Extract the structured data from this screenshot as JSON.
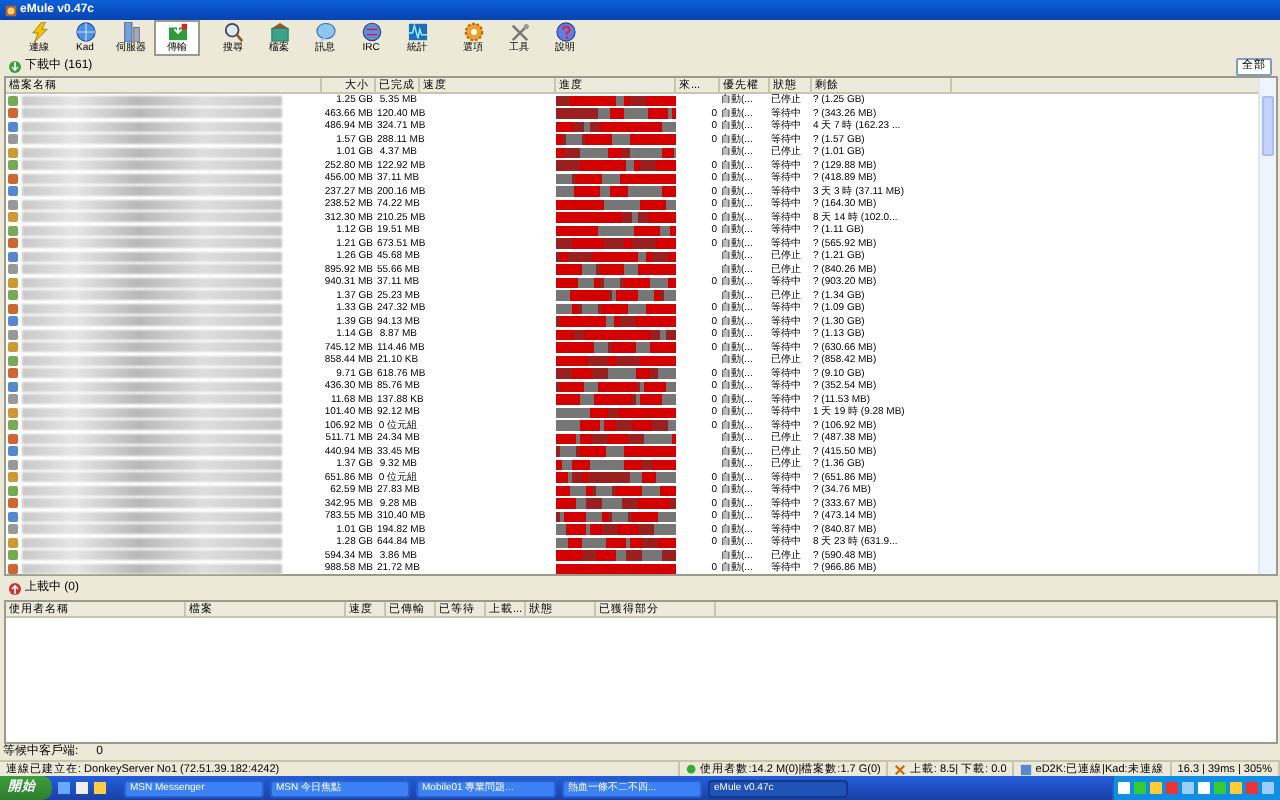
{
  "window": {
    "title": "eMule v0.47c"
  },
  "toolbar": [
    {
      "label": "連線",
      "selected": false
    },
    {
      "label": "Kad",
      "selected": false
    },
    {
      "label": "伺服器",
      "selected": false
    },
    {
      "label": "傳輸",
      "selected": true
    },
    {
      "label": "搜尋",
      "selected": false
    },
    {
      "label": "檔案",
      "selected": false
    },
    {
      "label": "訊息",
      "selected": false
    },
    {
      "label": "IRC",
      "selected": false
    },
    {
      "label": "統計",
      "selected": false
    },
    {
      "label": "選項",
      "selected": false
    },
    {
      "label": "工具",
      "selected": false
    },
    {
      "label": "說明",
      "selected": false
    }
  ],
  "downloads": {
    "tab": "下載中 (161)",
    "filter_button": "全部",
    "columns": [
      "檔案名稱",
      "大小",
      "已完成",
      "速度",
      "進度",
      "來...",
      "優先權",
      "狀態",
      "剩餘"
    ],
    "rows": [
      {
        "size": "1.25 GB",
        "completed": "5.35 MB",
        "sources": "",
        "priority": "自動(...",
        "status": "已停止",
        "remaining": "? (1.25 GB)"
      },
      {
        "size": "463.66 MB",
        "completed": "120.40 MB",
        "sources": "0",
        "priority": "自動(...",
        "status": "等待中",
        "remaining": "? (343.26 MB)"
      },
      {
        "size": "486.94 MB",
        "completed": "324.71 MB",
        "sources": "0",
        "priority": "自動(...",
        "status": "等待中",
        "remaining": "4 天 7 時 (162.23 ..."
      },
      {
        "size": "1.57 GB",
        "completed": "288.11 MB",
        "sources": "0",
        "priority": "自動(...",
        "status": "等待中",
        "remaining": "? (1.57 GB)"
      },
      {
        "size": "1.01 GB",
        "completed": "4.37 MB",
        "sources": "",
        "priority": "自動(...",
        "status": "已停止",
        "remaining": "? (1.01 GB)"
      },
      {
        "size": "252.80 MB",
        "completed": "122.92 MB",
        "sources": "0",
        "priority": "自動(...",
        "status": "等待中",
        "remaining": "? (129.88 MB)"
      },
      {
        "size": "456.00 MB",
        "completed": "37.11 MB",
        "sources": "0",
        "priority": "自動(...",
        "status": "等待中",
        "remaining": "? (418.89 MB)"
      },
      {
        "size": "237.27 MB",
        "completed": "200.16 MB",
        "sources": "0",
        "priority": "自動(...",
        "status": "等待中",
        "remaining": "3 天 3 時 (37.11 MB)"
      },
      {
        "size": "238.52 MB",
        "completed": "74.22 MB",
        "sources": "0",
        "priority": "自動(...",
        "status": "等待中",
        "remaining": "? (164.30 MB)"
      },
      {
        "size": "312.30 MB",
        "completed": "210.25 MB",
        "sources": "0",
        "priority": "自動(...",
        "status": "等待中",
        "remaining": "8 天 14 時 (102.0..."
      },
      {
        "size": "1.12 GB",
        "completed": "19.51 MB",
        "sources": "0",
        "priority": "自動(...",
        "status": "等待中",
        "remaining": "? (1.11 GB)"
      },
      {
        "size": "1.21 GB",
        "completed": "673.51 MB",
        "sources": "0",
        "priority": "自動(...",
        "status": "等待中",
        "remaining": "? (565.92 MB)"
      },
      {
        "size": "1.26 GB",
        "completed": "45.68 MB",
        "sources": "",
        "priority": "自動(...",
        "status": "已停止",
        "remaining": "? (1.21 GB)"
      },
      {
        "size": "895.92 MB",
        "completed": "55.66 MB",
        "sources": "",
        "priority": "自動(...",
        "status": "已停止",
        "remaining": "? (840.26 MB)"
      },
      {
        "size": "940.31 MB",
        "completed": "37.11 MB",
        "sources": "0",
        "priority": "自動(...",
        "status": "等待中",
        "remaining": "? (903.20 MB)"
      },
      {
        "size": "1.37 GB",
        "completed": "25.23 MB",
        "sources": "",
        "priority": "自動(...",
        "status": "已停止",
        "remaining": "? (1.34 GB)"
      },
      {
        "size": "1.33 GB",
        "completed": "247.32 MB",
        "sources": "0",
        "priority": "自動(...",
        "status": "等待中",
        "remaining": "? (1.09 GB)"
      },
      {
        "size": "1.39 GB",
        "completed": "94.13 MB",
        "sources": "0",
        "priority": "自動(...",
        "status": "等待中",
        "remaining": "? (1.30 GB)"
      },
      {
        "size": "1.14 GB",
        "completed": "8.87 MB",
        "sources": "0",
        "priority": "自動(...",
        "status": "等待中",
        "remaining": "? (1.13 GB)"
      },
      {
        "size": "745.12 MB",
        "completed": "114.46 MB",
        "sources": "0",
        "priority": "自動(...",
        "status": "等待中",
        "remaining": "? (630.66 MB)"
      },
      {
        "size": "858.44 MB",
        "completed": "21.10 KB",
        "sources": "",
        "priority": "自動(...",
        "status": "已停止",
        "remaining": "? (858.42 MB)"
      },
      {
        "size": "9.71 GB",
        "completed": "618.76 MB",
        "sources": "0",
        "priority": "自動(...",
        "status": "等待中",
        "remaining": "? (9.10 GB)"
      },
      {
        "size": "436.30 MB",
        "completed": "85.76 MB",
        "sources": "0",
        "priority": "自動(...",
        "status": "等待中",
        "remaining": "? (352.54 MB)"
      },
      {
        "size": "11.68 MB",
        "completed": "137.88 KB",
        "sources": "0",
        "priority": "自動(...",
        "status": "等待中",
        "remaining": "? (11.53 MB)"
      },
      {
        "size": "101.40 MB",
        "completed": "92.12 MB",
        "sources": "0",
        "priority": "自動(...",
        "status": "等待中",
        "remaining": "1 天 19 時 (9.28 MB)"
      },
      {
        "size": "106.92 MB",
        "completed": "0 位元組",
        "sources": "0",
        "priority": "自動(...",
        "status": "等待中",
        "remaining": "? (106.92 MB)"
      },
      {
        "size": "511.71 MB",
        "completed": "24.34 MB",
        "sources": "",
        "priority": "自動(...",
        "status": "已停止",
        "remaining": "? (487.38 MB)"
      },
      {
        "size": "440.94 MB",
        "completed": "33.45 MB",
        "sources": "",
        "priority": "自動(...",
        "status": "已停止",
        "remaining": "? (415.50 MB)"
      },
      {
        "size": "1.37 GB",
        "completed": "9.32 MB",
        "sources": "",
        "priority": "自動(...",
        "status": "已停止",
        "remaining": "? (1.36 GB)"
      },
      {
        "size": "651.86 MB",
        "completed": "0 位元組",
        "sources": "0",
        "priority": "自動(...",
        "status": "等待中",
        "remaining": "? (651.86 MB)"
      },
      {
        "size": "62.59 MB",
        "completed": "27.83 MB",
        "sources": "0",
        "priority": "自動(...",
        "status": "等待中",
        "remaining": "? (34.76 MB)"
      },
      {
        "size": "342.95 MB",
        "completed": "9.28 MB",
        "sources": "0",
        "priority": "自動(...",
        "status": "等待中",
        "remaining": "? (333.67 MB)"
      },
      {
        "size": "783.55 MB",
        "completed": "310.40 MB",
        "sources": "0",
        "priority": "自動(...",
        "status": "等待中",
        "remaining": "? (473.14 MB)"
      },
      {
        "size": "1.01 GB",
        "completed": "194.82 MB",
        "sources": "0",
        "priority": "自動(...",
        "status": "等待中",
        "remaining": "? (840.87 MB)"
      },
      {
        "size": "1.28 GB",
        "completed": "644.84 MB",
        "sources": "0",
        "priority": "自動(...",
        "status": "等待中",
        "remaining": "8 天 23 時 (631.9..."
      },
      {
        "size": "594.34 MB",
        "completed": "3.86 MB",
        "sources": "",
        "priority": "自動(...",
        "status": "已停止",
        "remaining": "? (590.48 MB)"
      },
      {
        "size": "988.58 MB",
        "completed": "21.72 MB",
        "sources": "0",
        "priority": "自動(...",
        "status": "等待中",
        "remaining": "? (966.86 MB)"
      }
    ]
  },
  "uploads": {
    "label": "上載中 (0)",
    "columns": [
      "使用者名稱",
      "檔案",
      "速度",
      "已傳輸",
      "已等待",
      "上載...",
      "狀態",
      "已獲得部分"
    ]
  },
  "queue": {
    "label": "等候中客戶端:",
    "count": "0"
  },
  "status_bar": [
    "連線已建立在: DonkeyServer No1 (72.51.39.182:4242)",
    "使用者數:14.2 M(0)|檔案數:1.7 G(0)",
    "上載: 8.5| 下載: 0.0",
    "eD2K:已連線|Kad:未連線",
    "16.3 | 39ms | 305%"
  ],
  "taskbar": {
    "start": "開始",
    "tasks": [
      {
        "label": "MSN Messenger",
        "selected": false
      },
      {
        "label": "MSN 今日焦點",
        "selected": false
      },
      {
        "label": "Mobile01 專業問題...",
        "selected": false
      },
      {
        "label": "熱血一條不二不四...",
        "selected": false
      },
      {
        "label": "eMule v0.47c",
        "selected": true
      }
    ]
  }
}
